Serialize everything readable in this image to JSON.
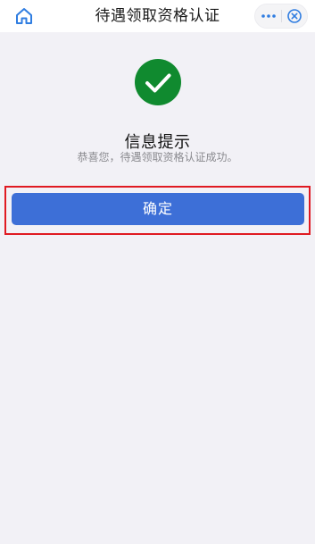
{
  "nav": {
    "title": "待遇领取资格认证",
    "home_icon": "home-icon",
    "more_icon": "more-icon",
    "close_icon": "close-icon"
  },
  "result": {
    "icon": "check-circle-icon",
    "title": "信息提示",
    "description": "恭喜您，待遇领取资格认证成功。"
  },
  "actions": {
    "confirm_label": "确定"
  },
  "colors": {
    "primary": "#3d6fd7",
    "success": "#108a2f",
    "highlight_border": "#e01a22",
    "nav_icon": "#2f7de1",
    "background": "#f2f1f6"
  }
}
